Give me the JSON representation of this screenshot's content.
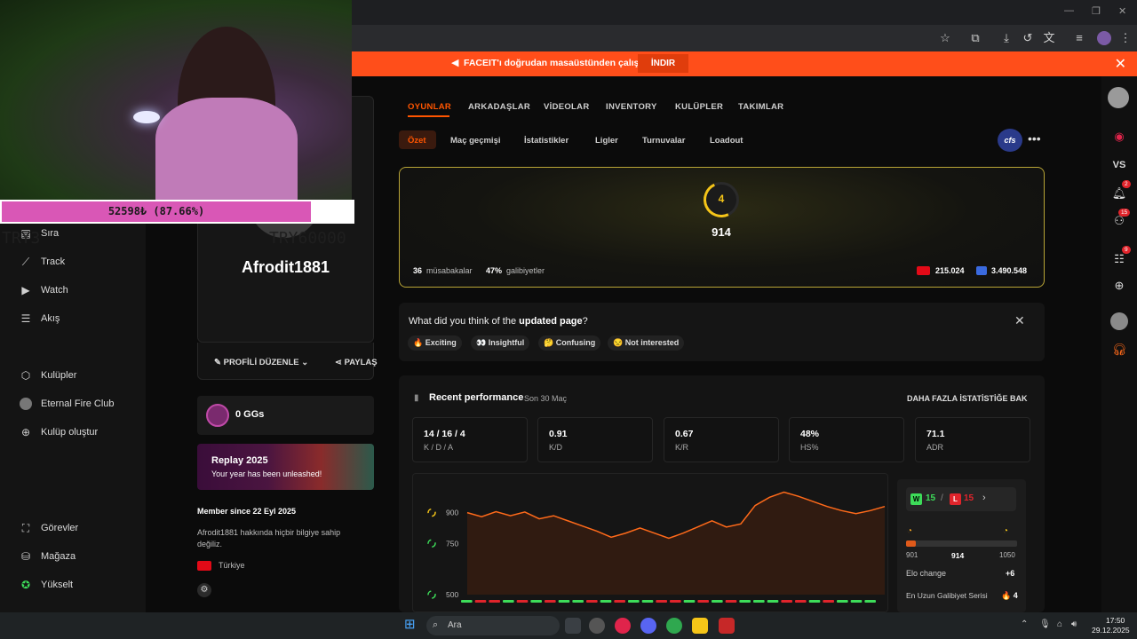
{
  "banner": {
    "text": "FACEIT'ı doğrudan masaüstünden çalıştır!",
    "button": "İNDIR"
  },
  "nav": {
    "items": [
      {
        "label": "Sıra",
        "icon": "rank-icon"
      },
      {
        "label": "Track",
        "icon": "chart-icon"
      },
      {
        "label": "Watch",
        "icon": "video-icon"
      },
      {
        "label": "Akış",
        "icon": "feed-icon"
      }
    ],
    "clubs": [
      {
        "label": "Kulüpler",
        "icon": "club-icon"
      },
      {
        "label": "Eternal Fire Club",
        "icon": "club-avatar-icon"
      },
      {
        "label": "Kulüp oluştur",
        "icon": "plus-circle-icon"
      }
    ],
    "bottom": [
      {
        "label": "Görevler",
        "icon": "missions-icon"
      },
      {
        "label": "Mağaza",
        "icon": "shop-icon"
      },
      {
        "label": "Yükselt",
        "icon": "upgrade-icon"
      }
    ]
  },
  "overlay": {
    "progress_text": "52598₺ (87.66%)",
    "progress": 0.8766,
    "left_tag": "TRY3",
    "right_tag": "TRY60000"
  },
  "profile": {
    "username": "Afrodit1881",
    "edit_label": "PROFİLİ DÜZENLE",
    "share_label": "PAYLAŞ",
    "gg": "0 GGs",
    "replay_title": "Replay 2025",
    "replay_sub": "Your year has been unleashed!",
    "member_since": "Member since 22 Eyl 2025",
    "bio": "Afrodit1881 hakkında hiçbir bilgiye sahip değiliz.",
    "country": "Türkiye"
  },
  "tabs": [
    "OYUNLAR",
    "ARKADAŞLAR",
    "VİDEOLAR",
    "INVENTORY",
    "KULÜPLER",
    "TAKIMLAR"
  ],
  "subtabs": [
    "Özet",
    "Maç geçmişi",
    "İstatistikler",
    "Ligler",
    "Turnuvalar",
    "Loadout"
  ],
  "game_badge": "cfs",
  "elo": {
    "level": "4",
    "value": "914",
    "matches_num": "36",
    "matches_label": "müsabakalar",
    "winrate_num": "47%",
    "winrate_label": "galibiyetler",
    "country_rank": "215.024",
    "region_rank": "3.490.548"
  },
  "feedback": {
    "question_pre": "What did you think of the ",
    "question_bold": "updated page",
    "question_post": "?",
    "chips": [
      "🔥 Exciting",
      "👀 Insightful",
      "🤔 Confusing",
      "😒 Not interested"
    ]
  },
  "performance": {
    "title": "Recent performance",
    "subtitle": "Son 30 Maç",
    "more": "DAHA FAZLA İSTATİSTİĞE BAK",
    "stats": [
      {
        "value": "14 / 16 / 4",
        "label": "K / D / A"
      },
      {
        "value": "0.91",
        "label": "K/D"
      },
      {
        "value": "0.67",
        "label": "K/R"
      },
      {
        "value": "48%",
        "label": "HS%"
      },
      {
        "value": "71.1",
        "label": "ADR"
      }
    ],
    "wins": "15",
    "losses": "15",
    "elo_min": "901",
    "elo_current": "914",
    "elo_max": "1050",
    "elo_change_label": "Elo change",
    "elo_change": "+6",
    "streak_label": "En Uzun Galibiyet Serisi",
    "streak": "🔥 4"
  },
  "chart_data": {
    "type": "line",
    "ylabels": [
      "900",
      "750",
      "500"
    ],
    "ylim": [
      500,
      1050
    ],
    "values": [
      900,
      880,
      905,
      885,
      903,
      870,
      885,
      860,
      835,
      810,
      780,
      800,
      825,
      800,
      775,
      800,
      830,
      860,
      830,
      845,
      935,
      975,
      1000,
      980,
      955,
      930,
      910,
      895,
      910,
      930
    ],
    "results": [
      "W",
      "L",
      "L",
      "W",
      "L",
      "W",
      "L",
      "W",
      "W",
      "L",
      "W",
      "L",
      "W",
      "W",
      "L",
      "L",
      "W",
      "L",
      "W",
      "L",
      "W",
      "W",
      "W",
      "L",
      "L",
      "W",
      "L",
      "W",
      "W",
      "W"
    ]
  },
  "taskbar": {
    "search": "Ara",
    "time": "17:50",
    "date": "29.12.2025"
  }
}
